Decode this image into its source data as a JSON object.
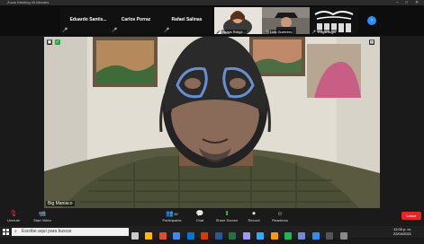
{
  "window": {
    "title": "Zoom Meeting 40 Minutes"
  },
  "participants": [
    {
      "name": "Eduardo  Santis..."
    },
    {
      "name": "Carlos Porraz"
    },
    {
      "name": "Rafael Salinas"
    },
    {
      "name": "Grays Rdrgz..."
    },
    {
      "name": "Luis Guerrero"
    },
    {
      "name": "Edgarduga"
    }
  ],
  "main_video": {
    "name": "Big Maniaco"
  },
  "toolbar": {
    "unmute": "Unmute",
    "start_video": "Start Video",
    "participants": "Participants",
    "participants_count": "26",
    "chat": "Chat",
    "share_screen": "Share Screen",
    "record": "Record",
    "reactions": "Reactions",
    "end": "Leave"
  },
  "taskbar": {
    "search_placeholder": "Escribe aquí para buscar",
    "time": "12:00 p. m.",
    "date": "22/04/2021"
  }
}
